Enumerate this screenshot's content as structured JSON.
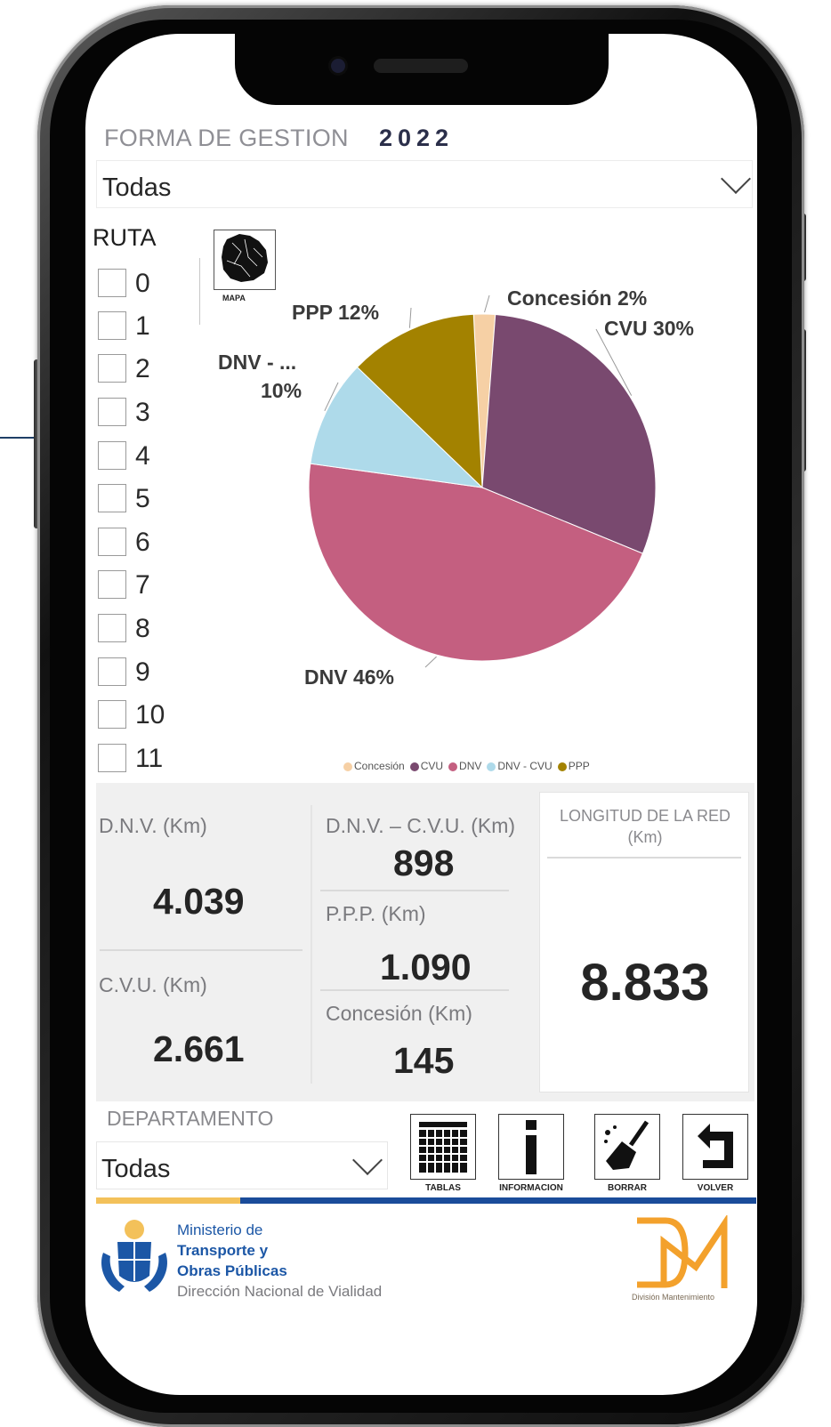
{
  "header": {
    "title_prefix": "FORMA DE GESTION",
    "year": "2022",
    "filter_value": "Todas"
  },
  "ruta": {
    "label": "RUTA",
    "items": [
      "0",
      "1",
      "2",
      "3",
      "4",
      "5",
      "6",
      "7",
      "8",
      "9",
      "10",
      "11"
    ]
  },
  "mapa": {
    "label": "MAPA",
    "icon": "uruguay-map-icon"
  },
  "chart_data": {
    "type": "pie",
    "slices": [
      {
        "name": "Concesión",
        "value": 2,
        "label": "Concesión 2%",
        "color": "#f6d0a5"
      },
      {
        "name": "CVU",
        "value": 30,
        "label": "CVU 30%",
        "color": "#79496f"
      },
      {
        "name": "DNV",
        "value": 46,
        "label": "DNV 46%",
        "color": "#c45f80"
      },
      {
        "name": "DNV - CVU",
        "value": 10,
        "label_line1": "DNV - ...",
        "label_line2": "10%",
        "color": "#aedaea"
      },
      {
        "name": "PPP",
        "value": 12,
        "label": "PPP 12%",
        "color": "#a38200"
      }
    ],
    "legend": [
      "Concesión",
      "CVU",
      "DNV",
      "DNV - CVU",
      "PPP"
    ],
    "legend_position": "bottom"
  },
  "stats": {
    "dnv": {
      "label": "D.N.V. (Km)",
      "value": "4.039"
    },
    "cvu": {
      "label": "C.V.U. (Km)",
      "value": "2.661"
    },
    "dnv_cvu": {
      "label": "D.N.V. – C.V.U. (Km)",
      "value": "898"
    },
    "ppp": {
      "label": "P.P.P. (Km)",
      "value": "1.090"
    },
    "concesion": {
      "label": "Concesión (Km)",
      "value": "145"
    },
    "total": {
      "label_line1": "LONGITUD DE LA RED",
      "label_line2": "(Km)",
      "value": "8.833"
    }
  },
  "departamento": {
    "label": "DEPARTAMENTO",
    "value": "Todas"
  },
  "actions": {
    "tablas": "TABLAS",
    "informacion": "INFORMACION",
    "borrar": "BORRAR",
    "volver": "VOLVER"
  },
  "footer": {
    "ministry_line1": "Ministerio de",
    "ministry_line2": "Transporte y",
    "ministry_line3": "Obras Públicas",
    "ministry_line4": "Dirección Nacional de Vialidad",
    "division": "División Mantenimiento"
  },
  "colors": {
    "brand_blue": "#1a4c9a",
    "brand_yellow": "#f3c15a",
    "dm_orange": "#f3a12c"
  }
}
